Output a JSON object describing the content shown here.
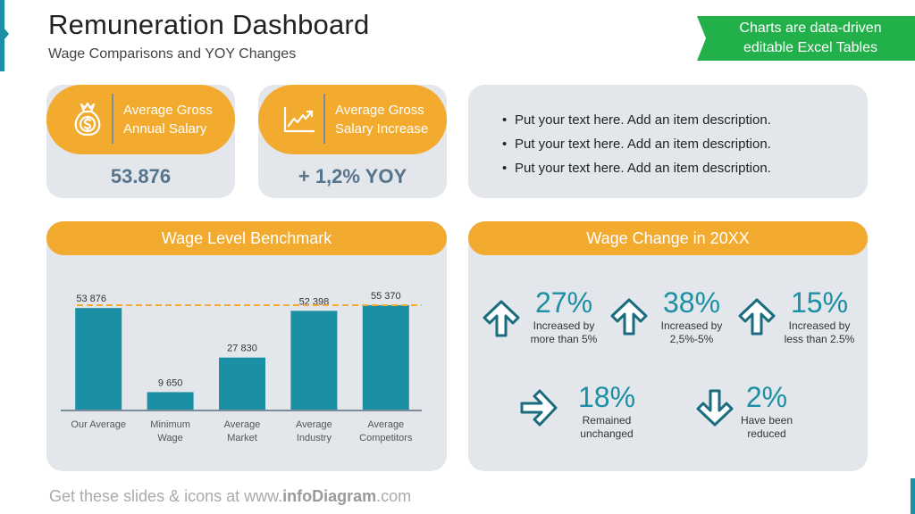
{
  "header": {
    "title": "Remuneration Dashboard",
    "subtitle": "Wage Comparisons and YOY Changes",
    "ribbon_line1": "Charts are data-driven",
    "ribbon_line2": "editable Excel Tables"
  },
  "kpis": [
    {
      "icon": "money-bag-icon",
      "label_line1": "Average Gross",
      "label_line2": "Annual Salary",
      "value": "53.876"
    },
    {
      "icon": "trend-chart-icon",
      "label_line1": "Average Gross",
      "label_line2": "Salary Increase",
      "value": "+ 1,2% YOY"
    }
  ],
  "notes": {
    "items": [
      "Put your text here. Add an item description.",
      "Put your text here. Add an item description.",
      "Put your text here. Add an item description."
    ]
  },
  "benchmark": {
    "title": "Wage Level Benchmark"
  },
  "wage_change": {
    "title": "Wage Change in 20XX",
    "stats": [
      {
        "icon": "arrow-up-icon",
        "percent": "27%",
        "desc_line1": "Increased by",
        "desc_line2": "more than 5%"
      },
      {
        "icon": "arrow-up-icon",
        "percent": "38%",
        "desc_line1": "Increased by",
        "desc_line2": "2,5%-5%"
      },
      {
        "icon": "arrow-up-icon",
        "percent": "15%",
        "desc_line1": "Increased by",
        "desc_line2": "less than 2.5%"
      },
      {
        "icon": "arrow-right-icon",
        "percent": "18%",
        "desc_line1": "Remained",
        "desc_line2": "unchanged"
      },
      {
        "icon": "arrow-down-icon",
        "percent": "2%",
        "desc_line1": "Have been",
        "desc_line2": "reduced"
      }
    ]
  },
  "footer": {
    "prefix": "Get these slides & icons at www.",
    "brand": "infoDiagram",
    "suffix": ".com"
  },
  "colors": {
    "accent_teal": "#1b8fa3",
    "accent_orange": "#f2ab2f",
    "ribbon_green": "#22b04b",
    "card_gray": "#e3e6eb",
    "kpi_value": "#56758d"
  },
  "chart_data": {
    "type": "bar",
    "title": "Wage Level Benchmark",
    "categories": [
      "Our Average",
      "Minimum Wage",
      "Average Market",
      "Average Industry",
      "Average Competitors"
    ],
    "category_lines": [
      [
        "Our Average"
      ],
      [
        "Minimum",
        "Wage"
      ],
      [
        "Average",
        "Market"
      ],
      [
        "Average",
        "Industry"
      ],
      [
        "Average",
        "Competitors"
      ]
    ],
    "values": [
      53876,
      9650,
      27830,
      52398,
      55370
    ],
    "value_labels": [
      "53 876",
      "9 650",
      "27 830",
      "52 398",
      "55 370"
    ],
    "reference_line": {
      "value": 55370,
      "style": "dashed",
      "color": "#f2ab2f"
    },
    "bar_color": "#1b8fa3",
    "xlabel": "",
    "ylabel": "",
    "ylim": [
      0,
      58000
    ],
    "grid": false,
    "legend": "none"
  }
}
